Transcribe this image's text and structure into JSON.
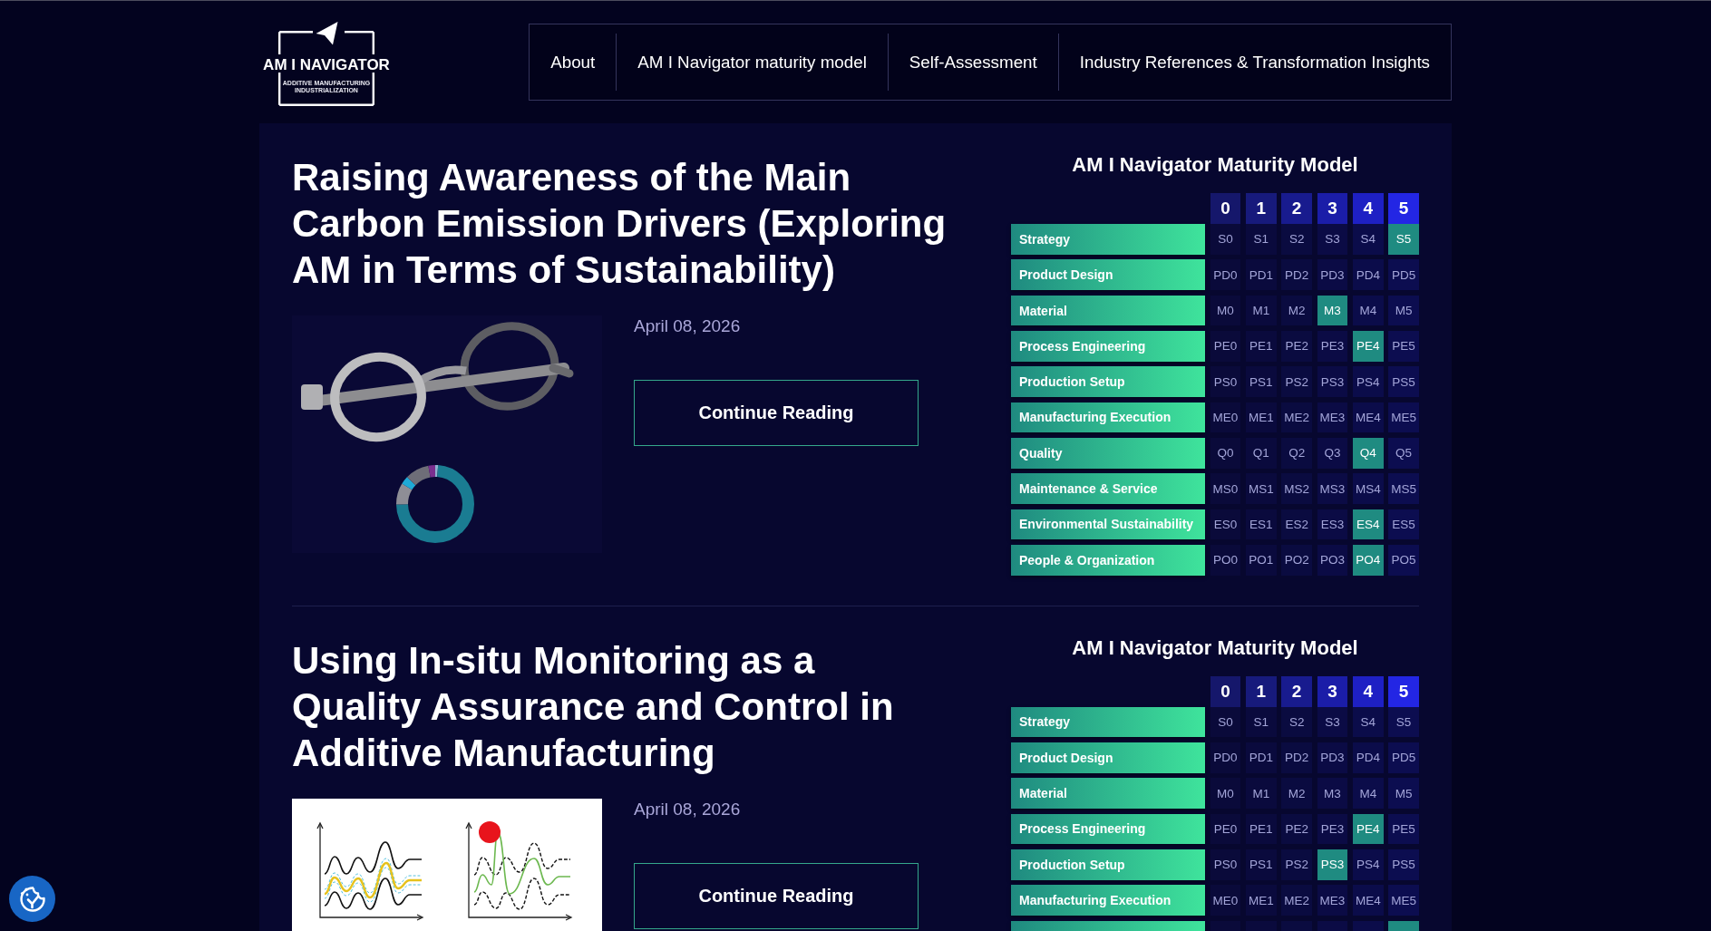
{
  "header": {
    "logo": {
      "wordmark": "AM I NAVIGATOR",
      "tagline": "ADDITIVE MANUFACTURING INDUSTRIALIZATION"
    },
    "nav": [
      {
        "label": "About"
      },
      {
        "label": "AM I Navigator maturity model"
      },
      {
        "label": "Self-Assessment"
      },
      {
        "label": "Industry References & Transformation Insights"
      }
    ]
  },
  "articles": [
    {
      "title": "Raising Awareness of the Main Carbon Emission Drivers (Exploring AM in Terms of Sustainability)",
      "thumbnail": {
        "kind": "photo"
      },
      "date": "April 08, 2026",
      "button": "Continue Reading",
      "maturity_model": {
        "title": "AM I Navigator Maturity Model",
        "levels": [
          {
            "label": "0",
            "color": "#15176b"
          },
          {
            "label": "1",
            "color": "#171a7c"
          },
          {
            "label": "2",
            "color": "#181b8e"
          },
          {
            "label": "3",
            "color": "#1b1da8"
          },
          {
            "label": "4",
            "color": "#1e20c4"
          },
          {
            "label": "5",
            "color": "#2326e4"
          }
        ],
        "rows": [
          {
            "label": "Strategy",
            "cells": [
              {
                "label": "S0",
                "selected": false
              },
              {
                "label": "S1",
                "selected": false
              },
              {
                "label": "S2",
                "selected": false
              },
              {
                "label": "S3",
                "selected": false
              },
              {
                "label": "S4",
                "selected": false
              },
              {
                "label": "S5",
                "selected": true
              }
            ]
          },
          {
            "label": "Product Design",
            "cells": [
              {
                "label": "PD0",
                "selected": false
              },
              {
                "label": "PD1",
                "selected": false
              },
              {
                "label": "PD2",
                "selected": false
              },
              {
                "label": "PD3",
                "selected": false
              },
              {
                "label": "PD4",
                "selected": false
              },
              {
                "label": "PD5",
                "selected": false
              }
            ]
          },
          {
            "label": "Material",
            "cells": [
              {
                "label": "M0",
                "selected": false
              },
              {
                "label": "M1",
                "selected": false
              },
              {
                "label": "M2",
                "selected": false
              },
              {
                "label": "M3",
                "selected": true
              },
              {
                "label": "M4",
                "selected": false
              },
              {
                "label": "M5",
                "selected": false
              }
            ]
          },
          {
            "label": "Process Engineering",
            "cells": [
              {
                "label": "PE0",
                "selected": false
              },
              {
                "label": "PE1",
                "selected": false
              },
              {
                "label": "PE2",
                "selected": false
              },
              {
                "label": "PE3",
                "selected": false
              },
              {
                "label": "PE4",
                "selected": true
              },
              {
                "label": "PE5",
                "selected": false
              }
            ]
          },
          {
            "label": "Production Setup",
            "cells": [
              {
                "label": "PS0",
                "selected": false
              },
              {
                "label": "PS1",
                "selected": false
              },
              {
                "label": "PS2",
                "selected": false
              },
              {
                "label": "PS3",
                "selected": false
              },
              {
                "label": "PS4",
                "selected": false
              },
              {
                "label": "PS5",
                "selected": false
              }
            ]
          },
          {
            "label": "Manufacturing Execution",
            "cells": [
              {
                "label": "ME0",
                "selected": false
              },
              {
                "label": "ME1",
                "selected": false
              },
              {
                "label": "ME2",
                "selected": false
              },
              {
                "label": "ME3",
                "selected": false
              },
              {
                "label": "ME4",
                "selected": false
              },
              {
                "label": "ME5",
                "selected": false
              }
            ]
          },
          {
            "label": "Quality",
            "cells": [
              {
                "label": "Q0",
                "selected": false
              },
              {
                "label": "Q1",
                "selected": false
              },
              {
                "label": "Q2",
                "selected": false
              },
              {
                "label": "Q3",
                "selected": false
              },
              {
                "label": "Q4",
                "selected": true
              },
              {
                "label": "Q5",
                "selected": false
              }
            ]
          },
          {
            "label": "Maintenance & Service",
            "cells": [
              {
                "label": "MS0",
                "selected": false
              },
              {
                "label": "MS1",
                "selected": false
              },
              {
                "label": "MS2",
                "selected": false
              },
              {
                "label": "MS3",
                "selected": false
              },
              {
                "label": "MS4",
                "selected": false
              },
              {
                "label": "MS5",
                "selected": false
              }
            ]
          },
          {
            "label": "Environmental Sustainability",
            "cells": [
              {
                "label": "ES0",
                "selected": false
              },
              {
                "label": "ES1",
                "selected": false
              },
              {
                "label": "ES2",
                "selected": false
              },
              {
                "label": "ES3",
                "selected": false
              },
              {
                "label": "ES4",
                "selected": true
              },
              {
                "label": "ES5",
                "selected": false
              }
            ]
          },
          {
            "label": "People & Organization",
            "cells": [
              {
                "label": "PO0",
                "selected": false
              },
              {
                "label": "PO1",
                "selected": false
              },
              {
                "label": "PO2",
                "selected": false
              },
              {
                "label": "PO3",
                "selected": false
              },
              {
                "label": "PO4",
                "selected": true
              },
              {
                "label": "PO5",
                "selected": false
              }
            ]
          }
        ]
      }
    },
    {
      "title": "Using In-situ Monitoring as a Quality Assurance and Control in Additive Manufacturing",
      "thumbnail": {
        "kind": "diagram"
      },
      "date": "April 08, 2026",
      "button": "Continue Reading",
      "maturity_model": {
        "title": "AM I Navigator Maturity Model",
        "levels": [
          {
            "label": "0",
            "color": "#15176b"
          },
          {
            "label": "1",
            "color": "#171a7c"
          },
          {
            "label": "2",
            "color": "#181b8e"
          },
          {
            "label": "3",
            "color": "#1b1da8"
          },
          {
            "label": "4",
            "color": "#1e20c4"
          },
          {
            "label": "5",
            "color": "#2326e4"
          }
        ],
        "rows": [
          {
            "label": "Strategy",
            "cells": [
              {
                "label": "S0",
                "selected": false
              },
              {
                "label": "S1",
                "selected": false
              },
              {
                "label": "S2",
                "selected": false
              },
              {
                "label": "S3",
                "selected": false
              },
              {
                "label": "S4",
                "selected": false
              },
              {
                "label": "S5",
                "selected": false
              }
            ]
          },
          {
            "label": "Product Design",
            "cells": [
              {
                "label": "PD0",
                "selected": false
              },
              {
                "label": "PD1",
                "selected": false
              },
              {
                "label": "PD2",
                "selected": false
              },
              {
                "label": "PD3",
                "selected": false
              },
              {
                "label": "PD4",
                "selected": false
              },
              {
                "label": "PD5",
                "selected": false
              }
            ]
          },
          {
            "label": "Material",
            "cells": [
              {
                "label": "M0",
                "selected": false
              },
              {
                "label": "M1",
                "selected": false
              },
              {
                "label": "M2",
                "selected": false
              },
              {
                "label": "M3",
                "selected": false
              },
              {
                "label": "M4",
                "selected": false
              },
              {
                "label": "M5",
                "selected": false
              }
            ]
          },
          {
            "label": "Process Engineering",
            "cells": [
              {
                "label": "PE0",
                "selected": false
              },
              {
                "label": "PE1",
                "selected": false
              },
              {
                "label": "PE2",
                "selected": false
              },
              {
                "label": "PE3",
                "selected": false
              },
              {
                "label": "PE4",
                "selected": true
              },
              {
                "label": "PE5",
                "selected": false
              }
            ]
          },
          {
            "label": "Production Setup",
            "cells": [
              {
                "label": "PS0",
                "selected": false
              },
              {
                "label": "PS1",
                "selected": false
              },
              {
                "label": "PS2",
                "selected": false
              },
              {
                "label": "PS3",
                "selected": true
              },
              {
                "label": "PS4",
                "selected": false
              },
              {
                "label": "PS5",
                "selected": false
              }
            ]
          },
          {
            "label": "Manufacturing Execution",
            "cells": [
              {
                "label": "ME0",
                "selected": false
              },
              {
                "label": "ME1",
                "selected": false
              },
              {
                "label": "ME2",
                "selected": false
              },
              {
                "label": "ME3",
                "selected": false
              },
              {
                "label": "ME4",
                "selected": false
              },
              {
                "label": "ME5",
                "selected": false
              }
            ]
          },
          {
            "cells": [
              {
                "selected": false
              },
              {
                "selected": false
              },
              {
                "selected": false
              },
              {
                "selected": false
              },
              {
                "selected": false
              },
              {
                "selected": true
              }
            ]
          }
        ]
      }
    }
  ]
}
